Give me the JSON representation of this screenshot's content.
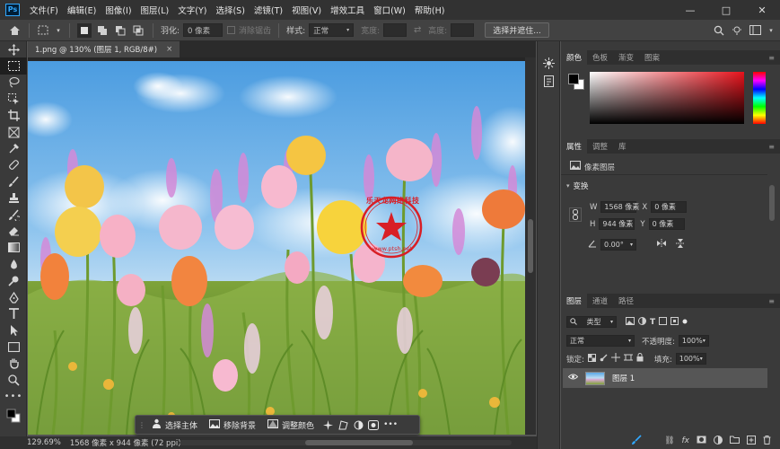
{
  "app": {
    "logo": "Ps"
  },
  "menu": [
    "文件(F)",
    "编辑(E)",
    "图像(I)",
    "图层(L)",
    "文字(Y)",
    "选择(S)",
    "滤镜(T)",
    "视图(V)",
    "增效工具",
    "窗口(W)",
    "帮助(H)"
  ],
  "window_controls": {
    "minimize": "—",
    "maximize": "□",
    "close": "✕"
  },
  "options": {
    "feather_label": "羽化:",
    "feather_value": "0 像素",
    "antialias": "消除锯齿",
    "style_label": "样式:",
    "style_value": "正常",
    "width_label": "宽度:",
    "height_label": "高度:",
    "select_mask_button": "选择并遮住..."
  },
  "document": {
    "tab_title": "1.png @ 130% (图层 1, RGB/8#)",
    "tab_close": "×"
  },
  "status": {
    "zoom": "129.69%",
    "info": "1568 像素 x 944 像素 (72 ppi)"
  },
  "context_bar": {
    "select_subject": "选择主体",
    "remove_bg": "移除背景",
    "adjust_color": "调整颜色",
    "more": "•••"
  },
  "watermark": {
    "text": "乐天龙网络科技",
    "url": "www.ptsh.net"
  },
  "panels": {
    "color_tabs": [
      "颜色",
      "色板",
      "渐变",
      "图案"
    ],
    "properties_tabs": [
      "属性",
      "调整",
      "库"
    ],
    "pixel_layer": "像素图层",
    "transform_title": "变换",
    "w_label": "W",
    "w_value": "1568 像素",
    "h_label": "H",
    "h_value": "944 像素",
    "x_label": "X",
    "x_value": "0 像素",
    "y_label": "Y",
    "y_value": "0 像素",
    "angle_value": "0.00°",
    "layers_tabs": [
      "图层",
      "通道",
      "路径"
    ],
    "filter_kind": "类型",
    "blend_mode": "正常",
    "opacity_label": "不透明度:",
    "opacity_value": "100%",
    "lock_label": "锁定:",
    "fill_label": "填充:",
    "fill_value": "100%",
    "layer_name": "图层 1"
  },
  "colors": {
    "accent": "#31a8ff",
    "foreground": "#000000",
    "background": "#ffffff",
    "watermark_red": "#d81f26"
  }
}
